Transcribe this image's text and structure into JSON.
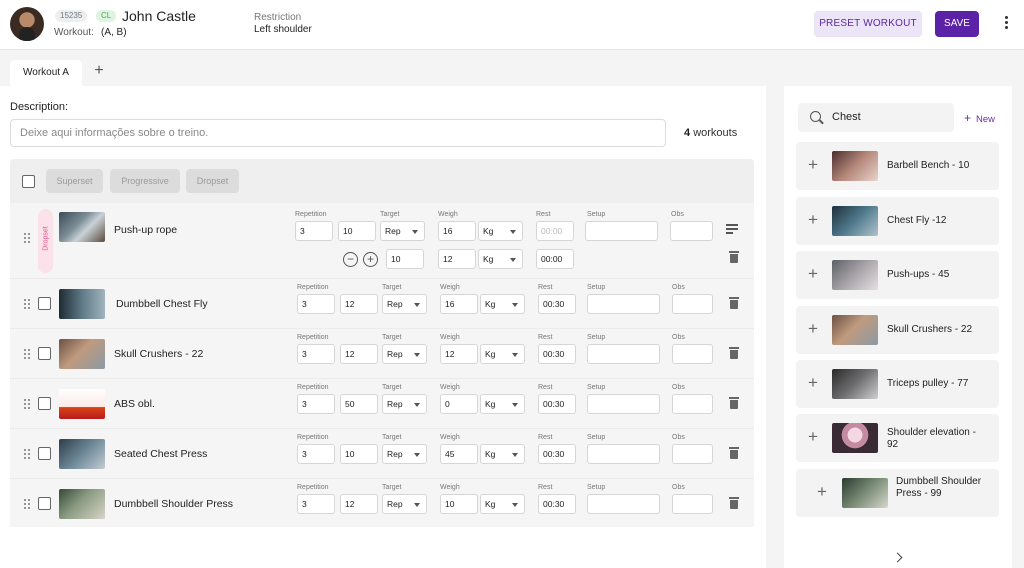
{
  "header": {
    "client_id": "15235",
    "client_tag": "CL",
    "client_name": "John Castle",
    "workout_label": "Workout:",
    "workout_value": "(A, B)",
    "restriction_label": "Restriction",
    "restriction_value": "Left shoulder",
    "preset_label": "PRESET WORKOUT",
    "save_label": "SAVE"
  },
  "tabs": [
    {
      "label": "Workout A",
      "active": true
    }
  ],
  "description": {
    "label": "Description:",
    "placeholder": "Deixe aqui informações sobre o treino.",
    "count_number": "4",
    "count_suffix": "workouts"
  },
  "toolbar": {
    "buttons": [
      "Superset",
      "Progressive",
      "Dropset"
    ]
  },
  "columns": {
    "repetition": "Repetition",
    "target": "Target",
    "weigh": "Weigh",
    "rest": "Rest",
    "setup": "Setup",
    "obs": "Obs"
  },
  "exercises": [
    {
      "name": "Push-up rope",
      "tag": "Dropset",
      "sets": "3",
      "reps": "10",
      "target": "Rep",
      "weight": "16",
      "unit": "Kg",
      "rest": "00:00",
      "drop": {
        "reps": "10",
        "weight": "12",
        "unit": "Kg",
        "rest": "00:00"
      }
    },
    {
      "name": "Dumbbell Chest Fly",
      "sets": "3",
      "reps": "12",
      "target": "Rep",
      "weight": "16",
      "unit": "Kg",
      "rest": "00:30"
    },
    {
      "name": "Skull Crushers - 22",
      "sets": "3",
      "reps": "12",
      "target": "Rep",
      "weight": "12",
      "unit": "Kg",
      "rest": "00:30"
    },
    {
      "name": "ABS obl.",
      "sets": "3",
      "reps": "50",
      "target": "Rep",
      "weight": "0",
      "unit": "Kg",
      "rest": "00:30"
    },
    {
      "name": "Seated Chest Press",
      "sets": "3",
      "reps": "10",
      "target": "Rep",
      "weight": "45",
      "unit": "Kg",
      "rest": "00:30"
    },
    {
      "name": "Dumbbell Shoulder Press",
      "sets": "3",
      "reps": "12",
      "target": "Rep",
      "weight": "10",
      "unit": "Kg",
      "rest": "00:30"
    }
  ],
  "library": {
    "search_value": "Chest",
    "new_label": "New",
    "items": [
      "Barbell Bench - 10",
      "Chest Fly -12",
      "Push-ups - 45",
      "Skull Crushers - 22",
      "Triceps pulley - 77",
      "Shoulder elevation - 92",
      "Dumbbell Shoulder Press - 99"
    ]
  },
  "icons": {
    "avatar": "avatar-photo",
    "more": "kebab-menu-icon",
    "add_tab": "plus-icon",
    "search": "search-icon",
    "delete": "trash-icon",
    "drag": "drag-handle-icon",
    "clear": "clear-list-icon",
    "next": "chevron-right-icon"
  },
  "colors": {
    "primary": "#5b21a6",
    "primary_light": "#ece4f7",
    "dropset_tag": "#fbe1ea"
  }
}
